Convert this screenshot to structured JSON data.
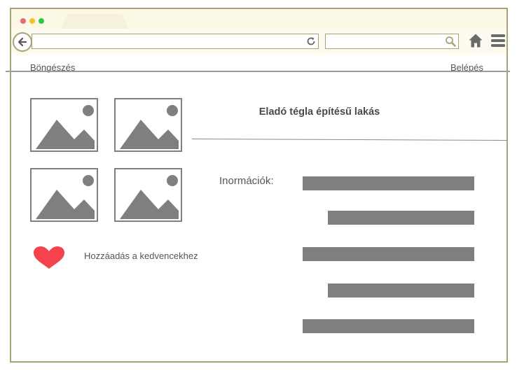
{
  "colors": {
    "frame": "#a8a277",
    "chrome_bg": "#fbf8e6",
    "placeholder": "#7f7f7f",
    "heart": "#f4424f",
    "dot_red": "#ee6a6a",
    "dot_yellow": "#f0c52a",
    "dot_green": "#33c748"
  },
  "nav": {
    "browse_label": "Böngészés",
    "login_label": "Belépés"
  },
  "listing": {
    "title": "Eladó tégla építésű lakás",
    "info_label": "Inormációk:",
    "image_count": 4
  },
  "favorite": {
    "label": "Hozzáadás a kedvencekhez",
    "icon": "heart-icon"
  },
  "icons": [
    "back-arrow-icon",
    "reload-icon",
    "search-icon",
    "home-icon",
    "menu-icon",
    "heart-icon",
    "image-placeholder-icon"
  ]
}
